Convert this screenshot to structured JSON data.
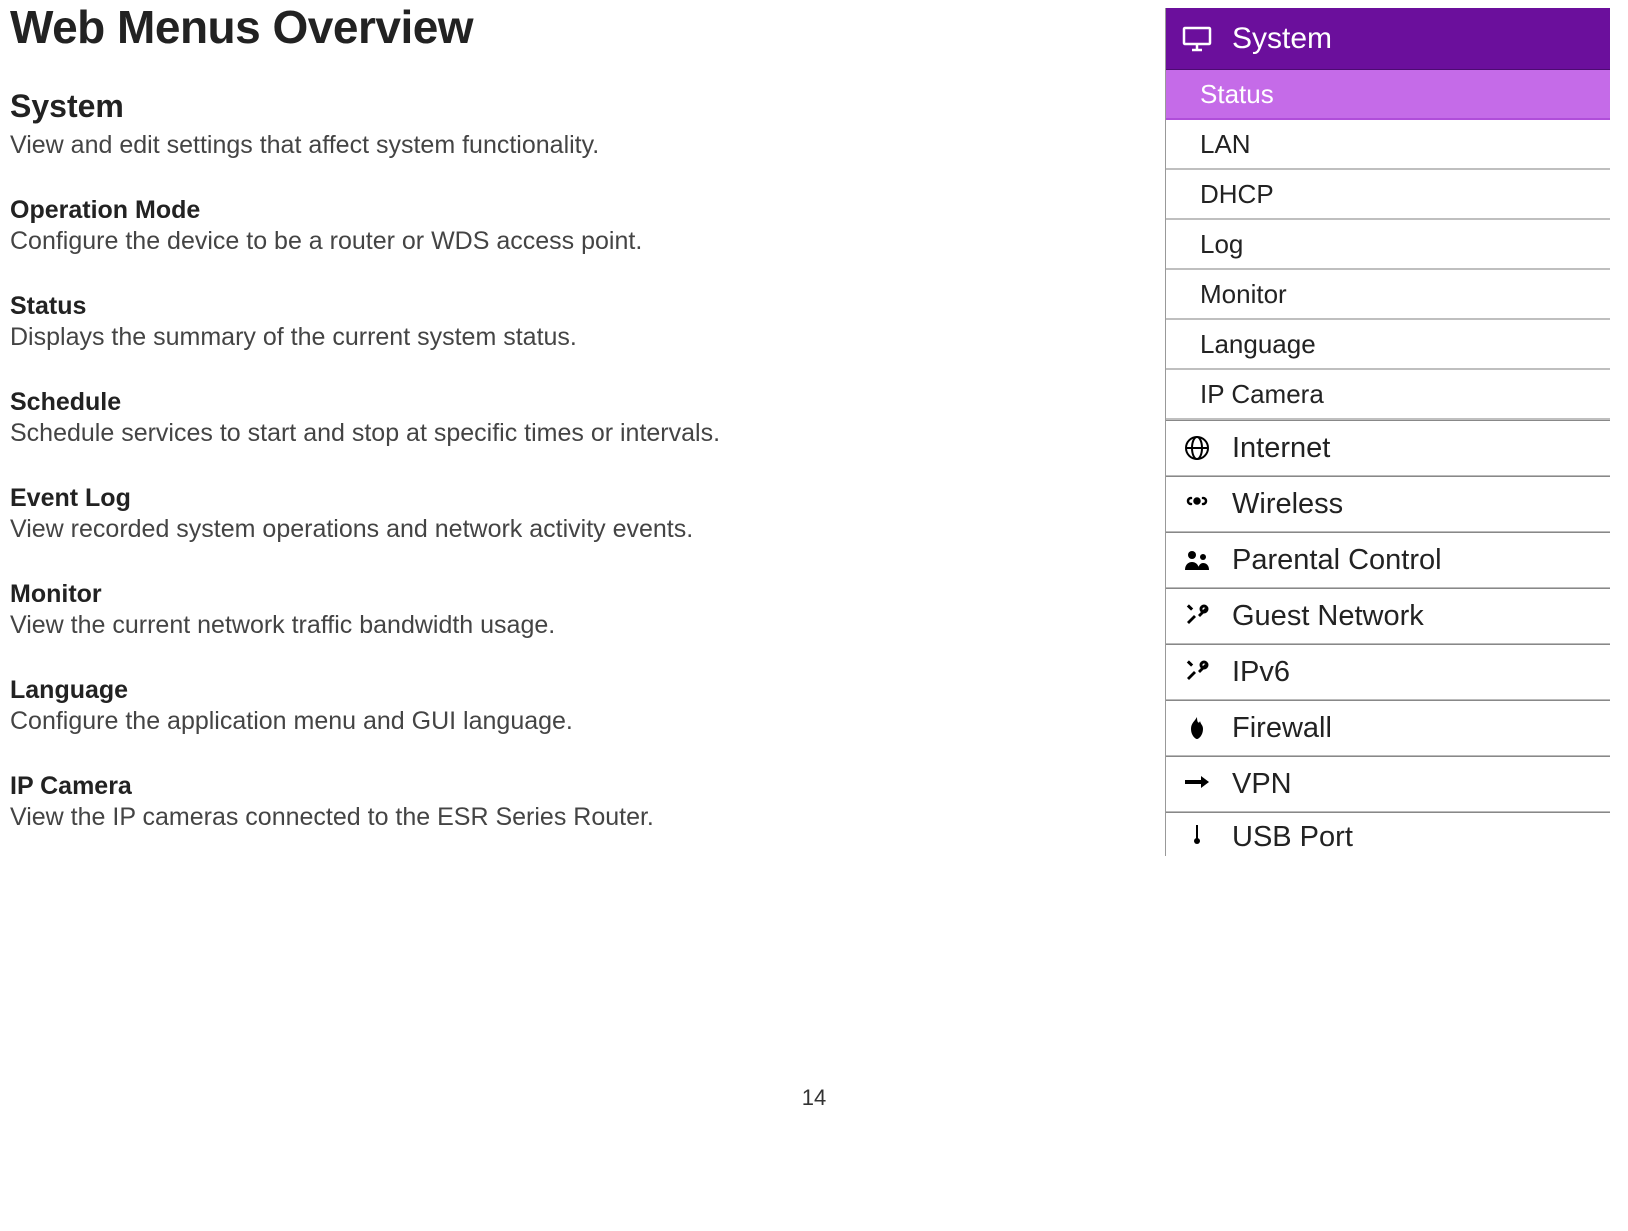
{
  "title": "Web Menus Overview",
  "page_number": "14",
  "section": {
    "heading": "System",
    "desc": "View and edit settings that affect system functionality."
  },
  "items": [
    {
      "heading": "Operation Mode",
      "desc": "Configure the device to be a router or WDS access point."
    },
    {
      "heading": "Status",
      "desc": "Displays the summary of the current system status."
    },
    {
      "heading": "Schedule",
      "desc": "Schedule services to start and stop at specific times or intervals."
    },
    {
      "heading": "Event Log",
      "desc": "View recorded system operations and network activity events."
    },
    {
      "heading": "Monitor",
      "desc": "View the current network traffic bandwidth usage."
    },
    {
      "heading": "Language",
      "desc": "Configure the application menu and GUI language."
    },
    {
      "heading": "IP Camera",
      "desc": "View the IP cameras connected to the ESR Series Router."
    }
  ],
  "menu": {
    "header": "System",
    "sub": [
      "Status",
      "LAN",
      "DHCP",
      "Log",
      "Monitor",
      "Language",
      "IP Camera"
    ],
    "top": [
      "Internet",
      "Wireless",
      "Parental Control",
      "Guest Network",
      "IPv6",
      "Firewall",
      "VPN",
      "USB Port"
    ]
  }
}
